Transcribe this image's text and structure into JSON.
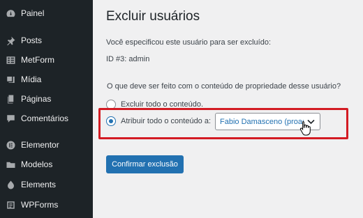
{
  "sidebar": {
    "items": [
      {
        "label": "Painel",
        "icon": "dashboard-icon"
      },
      {
        "label": "Posts",
        "icon": "pin-icon"
      },
      {
        "label": "MetForm",
        "icon": "form-icon"
      },
      {
        "label": "Mídia",
        "icon": "media-icon"
      },
      {
        "label": "Páginas",
        "icon": "pages-icon"
      },
      {
        "label": "Comentários",
        "icon": "comments-icon"
      },
      {
        "label": "Elementor",
        "icon": "elementor-icon"
      },
      {
        "label": "Modelos",
        "icon": "folder-icon"
      },
      {
        "label": "Elements",
        "icon": "elements-icon"
      },
      {
        "label": "WPForms",
        "icon": "wpforms-icon"
      }
    ]
  },
  "main": {
    "title": "Excluir usuários",
    "specified_text": "Você especificou este usuário para ser excluído:",
    "user_id_text": "ID #3: admin",
    "question": "O que deve ser feito com o conteúdo de propriedade desse usuário?",
    "option_delete": "Excluir todo o conteúdo.",
    "option_attribute": "Atribuir todo o conteúdo a:",
    "attribute_select_value": "Fabio Damasceno (proadm)",
    "confirm_button": "Confirmar exclusão"
  },
  "colors": {
    "sidebar_bg": "#1d2327",
    "accent": "#2271b1",
    "highlight_border": "#d31b23"
  }
}
